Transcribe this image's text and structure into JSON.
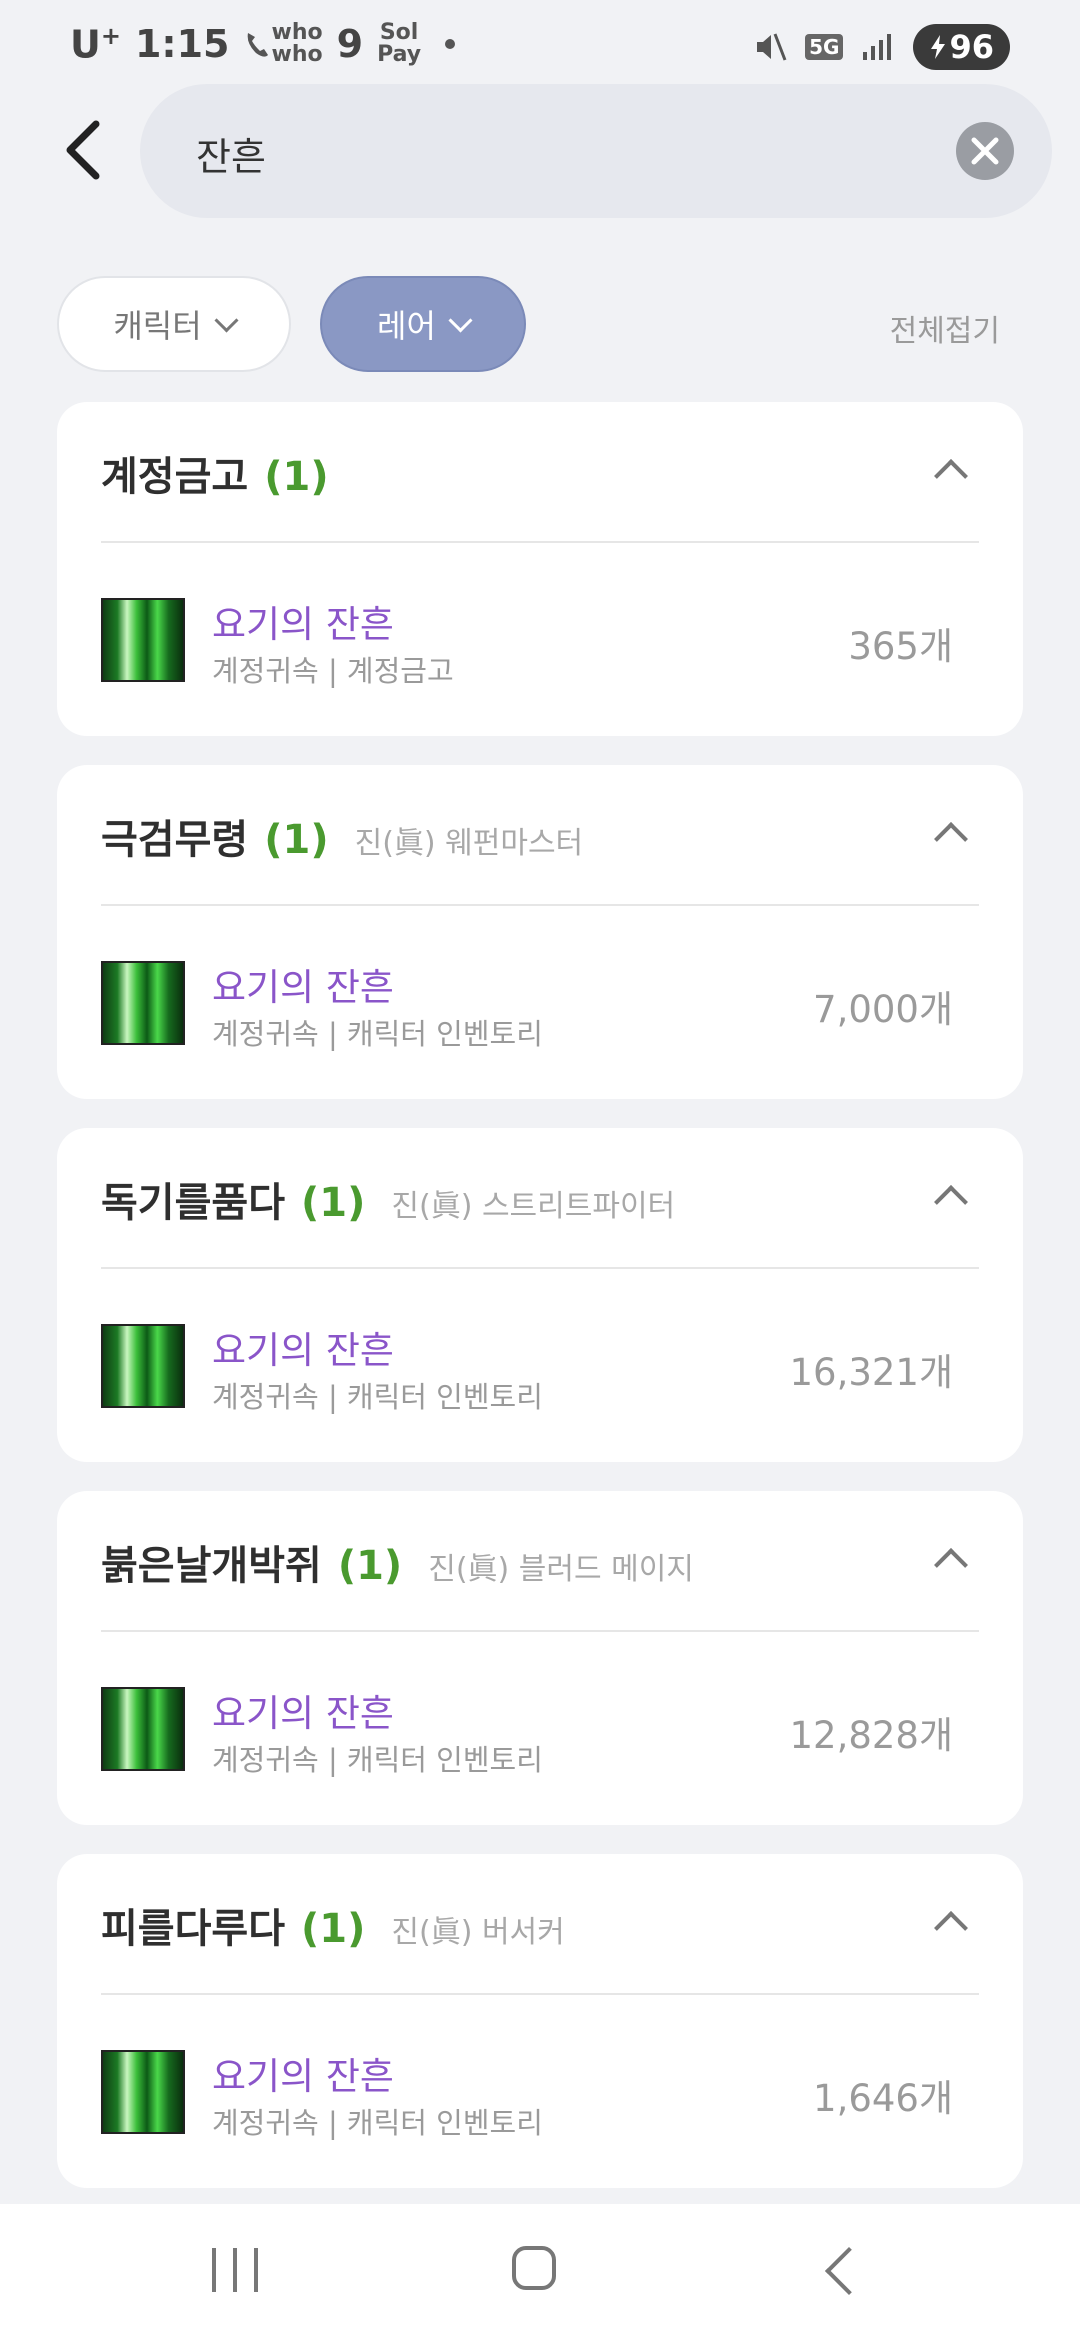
{
  "status_bar": {
    "carrier": "U",
    "carrier_sup": "+",
    "time": "1:15",
    "call_app_top": "who",
    "call_app_bottom": "who",
    "notif_count": "9",
    "pay_app_top": "Sol",
    "pay_app_bottom": "Pay",
    "network": "5G",
    "battery": "96"
  },
  "search": {
    "query": "잔흔"
  },
  "filters": {
    "character_label": "캐릭터",
    "rare_label": "레어",
    "collapse_all_label": "전체접기"
  },
  "groups": [
    {
      "title": "계정금고",
      "count": "(1)",
      "subtitle": "",
      "item": {
        "name": "요기의 잔흔",
        "meta": "계정귀속 | 계정금고",
        "qty": "365개"
      }
    },
    {
      "title": "극검무령",
      "count": "(1)",
      "subtitle": "진(眞) 웨펀마스터",
      "item": {
        "name": "요기의 잔흔",
        "meta": "계정귀속 | 캐릭터 인벤토리",
        "qty": "7,000개"
      }
    },
    {
      "title": "독기를품다",
      "count": "(1)",
      "subtitle": "진(眞) 스트리트파이터",
      "item": {
        "name": "요기의 잔흔",
        "meta": "계정귀속 | 캐릭터 인벤토리",
        "qty": "16,321개"
      }
    },
    {
      "title": "붉은날개박쥐",
      "count": "(1)",
      "subtitle": "진(眞) 블러드 메이지",
      "item": {
        "name": "요기의 잔흔",
        "meta": "계정귀속 | 캐릭터 인벤토리",
        "qty": "12,828개"
      }
    },
    {
      "title": "피를다루다",
      "count": "(1)",
      "subtitle": "진(眞) 버서커",
      "item": {
        "name": "요기의 잔흔",
        "meta": "계정귀속 | 캐릭터 인벤토리",
        "qty": "1,646개"
      }
    }
  ],
  "colors": {
    "accent_purple": "#8a55c9",
    "count_green": "#4a9a2f",
    "chip_active": "#8a98c4"
  }
}
